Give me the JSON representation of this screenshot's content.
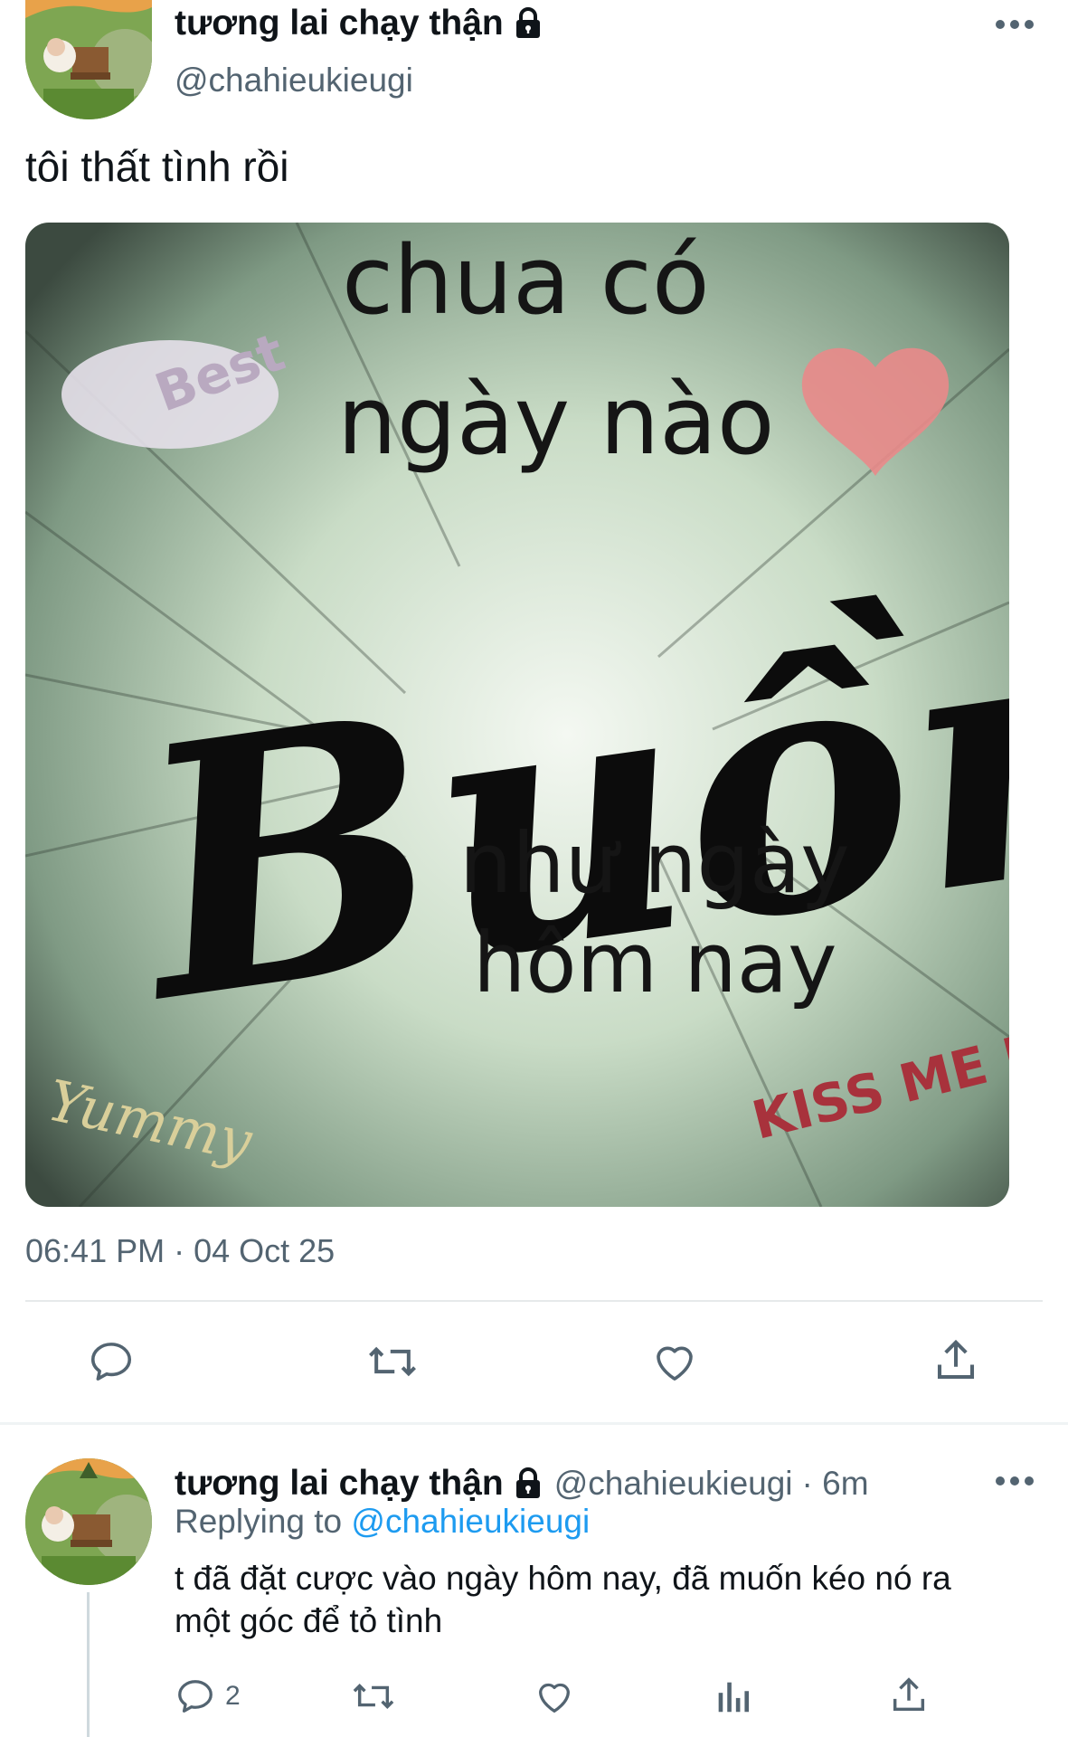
{
  "main_tweet": {
    "display_name": "tương lai chạy thận",
    "handle": "@chahieukieugi",
    "text": "tôi thất tình rồi",
    "image": {
      "lines": [
        "chua có",
        "ngày nào",
        "Buồn",
        "như ngày",
        "hôm nay"
      ],
      "stickers": [
        "Best",
        "Yummy",
        "KISS ME BABY"
      ]
    },
    "timestamp": "06:41 PM · 04 Oct 25",
    "actions": [
      {
        "name": "reply-icon"
      },
      {
        "name": "retweet-icon"
      },
      {
        "name": "like-icon"
      },
      {
        "name": "share-icon"
      }
    ]
  },
  "reply_tweet": {
    "display_name": "tương lai chạy thận",
    "handle": "@chahieukieugi",
    "time": "· 6m",
    "replying_prefix": "Replying to",
    "replying_to": "@chahieukieugi",
    "text_line1": "t đã đặt cược vào ngày hôm nay, đã muốn kéo nó ra",
    "text_line2": "một góc để tỏ tình",
    "reply_count": "2",
    "actions": [
      {
        "name": "reply-icon"
      },
      {
        "name": "retweet-icon"
      },
      {
        "name": "like-icon"
      },
      {
        "name": "analytics-icon"
      },
      {
        "name": "share-icon"
      }
    ]
  },
  "colors": {
    "accent": "#1d9bf0",
    "text": "#0f1419",
    "muted": "#536471"
  }
}
